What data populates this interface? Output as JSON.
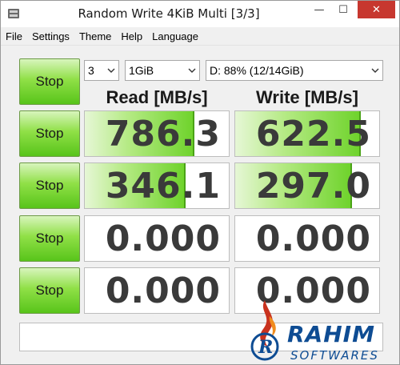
{
  "window": {
    "title": "Random Write 4KiB Multi [3/3]",
    "minimize_glyph": "—",
    "maximize_glyph": "☐",
    "close_glyph": "✕"
  },
  "menu": [
    "File",
    "Settings",
    "Theme",
    "Help",
    "Language"
  ],
  "controls": {
    "count": "3",
    "size": "1GiB",
    "drive": "D: 88% (12/14GiB)"
  },
  "headers": {
    "read": "Read [MB/s]",
    "write": "Write [MB/s]"
  },
  "buttons": {
    "stop": "Stop"
  },
  "rows": [
    {
      "read": "786.3",
      "write": "622.5",
      "read_fill": 0.76,
      "write_fill": 0.87
    },
    {
      "read": "346.1",
      "write": "297.0",
      "read_fill": 0.7,
      "write_fill": 0.81
    },
    {
      "read": "0.000",
      "write": "0.000",
      "read_fill": 0,
      "write_fill": 0
    },
    {
      "read": "0.000",
      "write": "0.000",
      "read_fill": 0,
      "write_fill": 0
    }
  ],
  "status_text": "",
  "watermark": {
    "line1": "RAHIM",
    "line2": "SOFTWARES"
  },
  "colors": {
    "accent_green": "#58c41a",
    "close_red": "#c7372f",
    "watermark_blue": "#0e4c93"
  }
}
